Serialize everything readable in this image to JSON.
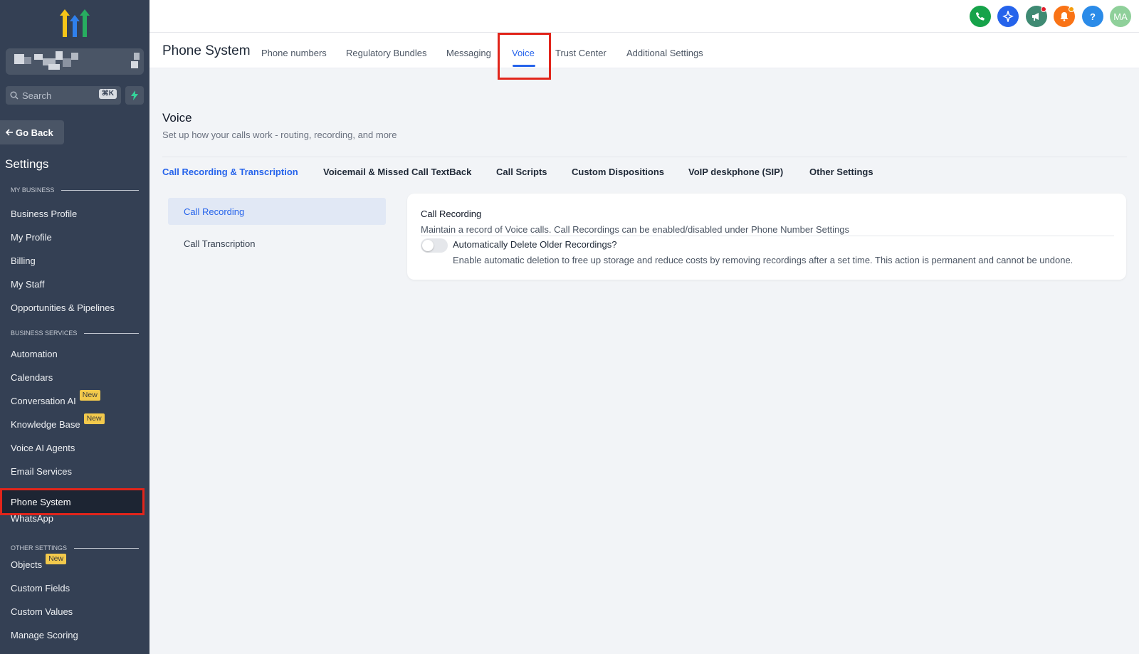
{
  "sidebar": {
    "search_placeholder": "Search",
    "search_shortcut": "⌘K",
    "go_back": "Go Back",
    "settings_title": "Settings",
    "sections": {
      "my_business": "MY BUSINESS",
      "business_services": "BUSINESS SERVICES",
      "other_settings": "OTHER SETTINGS"
    },
    "items": {
      "business_profile": "Business Profile",
      "my_profile": "My Profile",
      "billing": "Billing",
      "my_staff": "My Staff",
      "opportunities": "Opportunities & Pipelines",
      "automation": "Automation",
      "calendars": "Calendars",
      "conversation_ai": "Conversation AI",
      "knowledge_base": "Knowledge Base",
      "voice_ai_agents": "Voice AI Agents",
      "email_services": "Email Services",
      "phone_system": "Phone System",
      "whatsapp": "WhatsApp",
      "objects": "Objects",
      "custom_fields": "Custom Fields",
      "custom_values": "Custom Values",
      "manage_scoring": "Manage Scoring"
    },
    "badge_new": "New"
  },
  "topbar": {
    "avatar_initials": "MA",
    "help": "?",
    "icons": [
      "phone-icon",
      "sparkle-icon",
      "megaphone-icon",
      "bell-icon",
      "help-icon",
      "avatar"
    ],
    "colors": {
      "phone": "#16a34a",
      "sparkle": "#2563eb",
      "megaphone": "#3f8a73",
      "bell": "#f97316",
      "help": "#2b8be8",
      "avatar": "#8fd09a"
    }
  },
  "header": {
    "title": "Phone System",
    "tabs": {
      "phone_numbers": "Phone numbers",
      "regulatory_bundles": "Regulatory Bundles",
      "messaging": "Messaging",
      "voice": "Voice",
      "trust_center": "Trust Center",
      "additional_settings": "Additional Settings"
    },
    "active_tab": "Voice"
  },
  "main": {
    "title": "Voice",
    "subtitle": "Set up how your calls work - routing, recording, and more",
    "section_tabs": {
      "call_recording": "Call Recording & Transcription",
      "voicemail": "Voicemail & Missed Call TextBack",
      "call_scripts": "Call Scripts",
      "custom_dispositions": "Custom Dispositions",
      "voip": "VoIP deskphone (SIP)",
      "other": "Other Settings"
    },
    "left_menu": {
      "call_recording": "Call Recording",
      "call_transcription": "Call Transcription"
    },
    "card": {
      "title": "Call Recording",
      "description": "Maintain a record of Voice calls. Call Recordings can be enabled/disabled under Phone Number Settings",
      "toggle_label": "Automatically Delete Older Recordings?",
      "toggle_description": "Enable automatic deletion to free up storage and reduce costs by removing recordings after a set time. This action is permanent and cannot be undone.",
      "toggle_on": false
    }
  },
  "colors": {
    "accent": "#2563eb",
    "sidebar": "#344054",
    "highlight": "#e1251b"
  }
}
